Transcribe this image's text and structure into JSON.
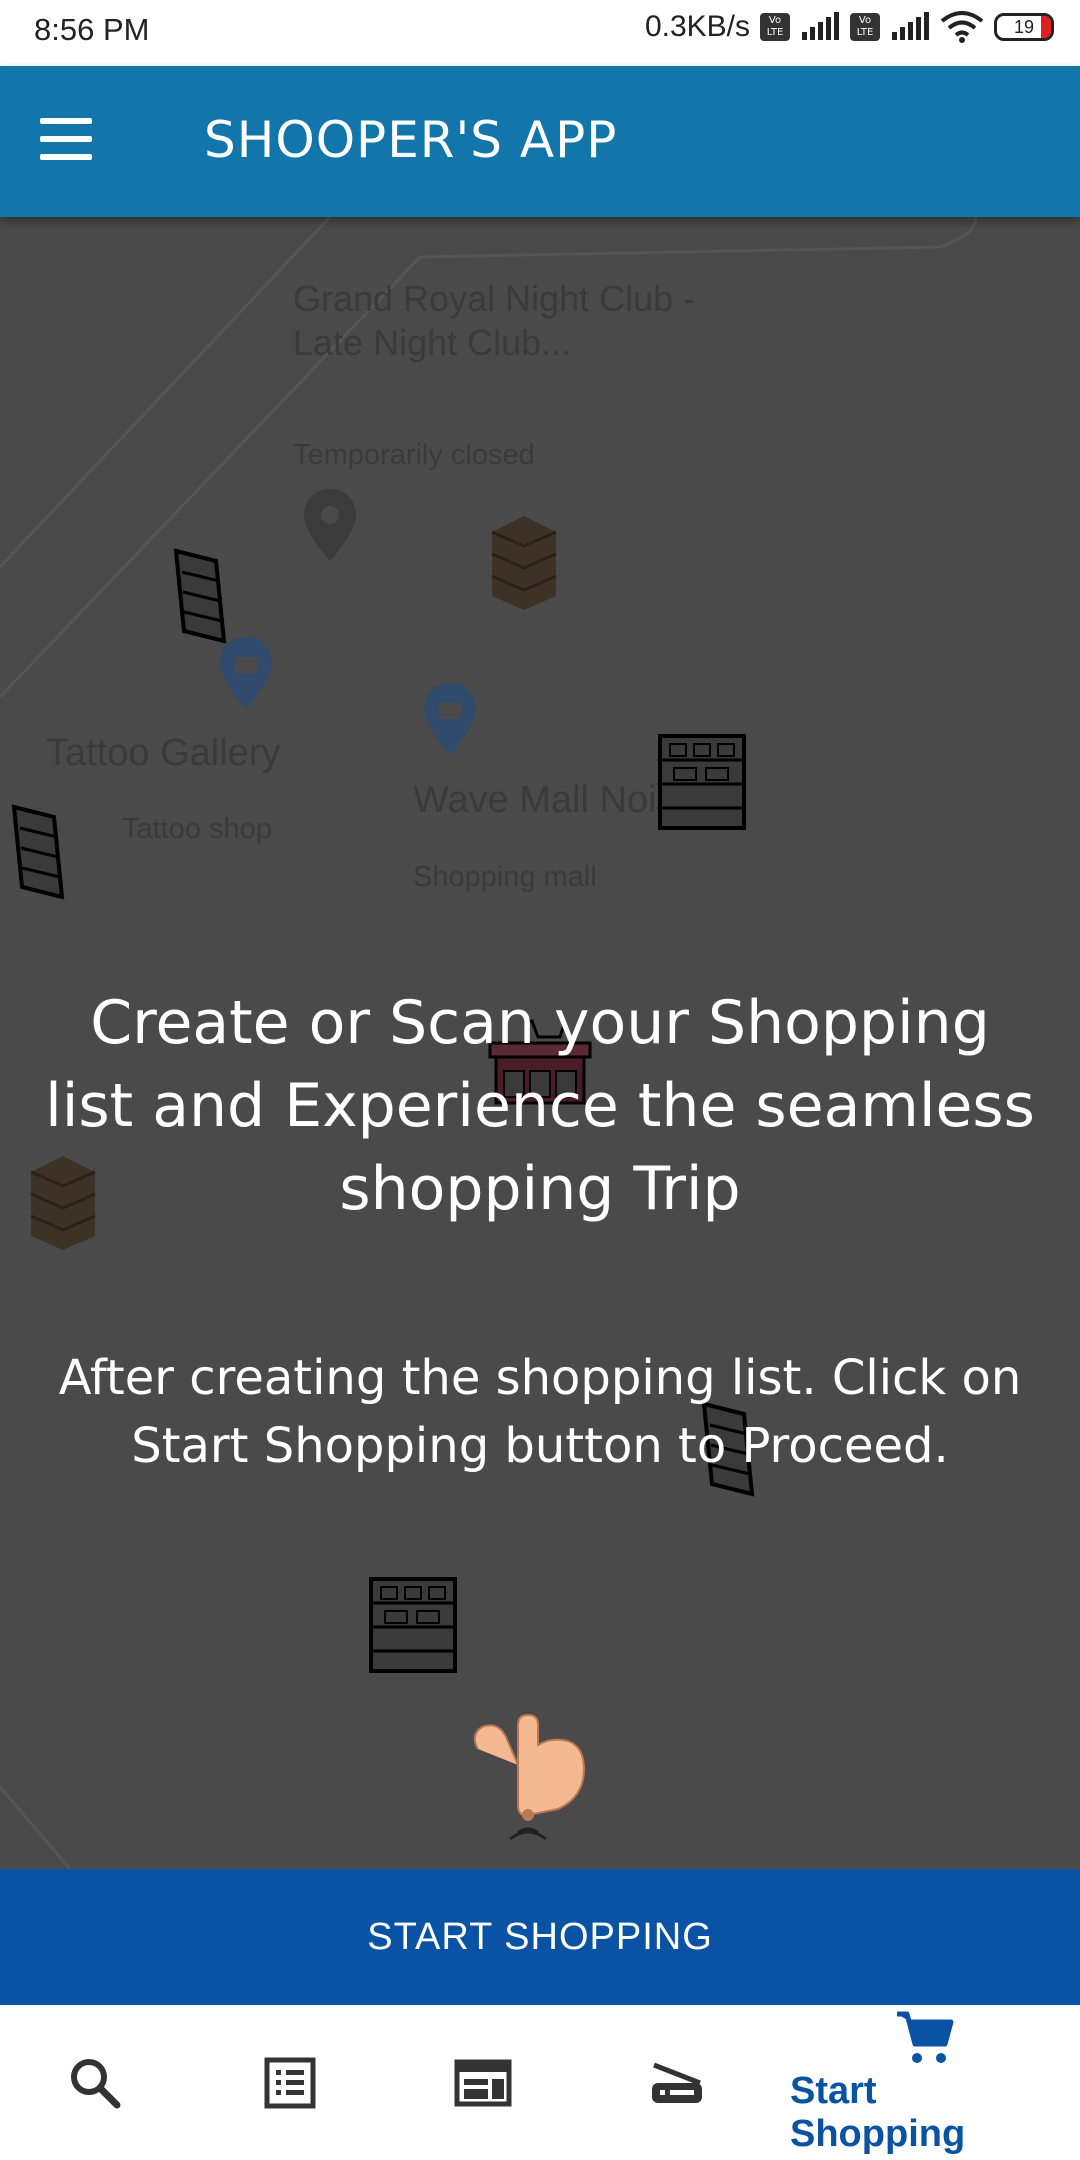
{
  "status_bar": {
    "time": "8:56 PM",
    "network_speed": "0.3KB/s",
    "volte_label": "Vo LTE",
    "battery_level": "19"
  },
  "app_bar": {
    "title": "SHOOPER'S APP",
    "menu_icon": "hamburger-menu-icon"
  },
  "map": {
    "places": [
      {
        "name": "Grand Royal Night Club - Late Night Club...",
        "detail": "Temporarily closed"
      },
      {
        "name": "Tattoo Gallery",
        "detail": "Tattoo shop"
      },
      {
        "name": "Wave Mall Noi",
        "detail": "Shopping mall"
      }
    ],
    "marker_icons": [
      "place-pin-icon",
      "shopping-bag-pin-icon",
      "shelf-icon",
      "stacked-goods-icon",
      "store-cart-icon",
      "tap-hand-icon"
    ]
  },
  "onboarding": {
    "title": "Create or Scan your Shopping list and Experience the seamless shopping Trip",
    "subtitle": "After creating the shopping list. Click on Start Shopping button to Proceed."
  },
  "start_button": {
    "label": "START SHOPPING"
  },
  "bottom_nav": {
    "items": [
      {
        "icon": "search-icon",
        "label": ""
      },
      {
        "icon": "list-icon",
        "label": ""
      },
      {
        "icon": "browser-window-icon",
        "label": ""
      },
      {
        "icon": "scanner-icon",
        "label": ""
      },
      {
        "icon": "cart-icon",
        "label": "Start Shopping",
        "active": true
      }
    ],
    "active_color": "#0a53a4",
    "inactive_color": "#333333"
  },
  "colors": {
    "app_bar": "#1276ab",
    "overlay": "#4a4a4a",
    "button": "#0a53a4"
  }
}
